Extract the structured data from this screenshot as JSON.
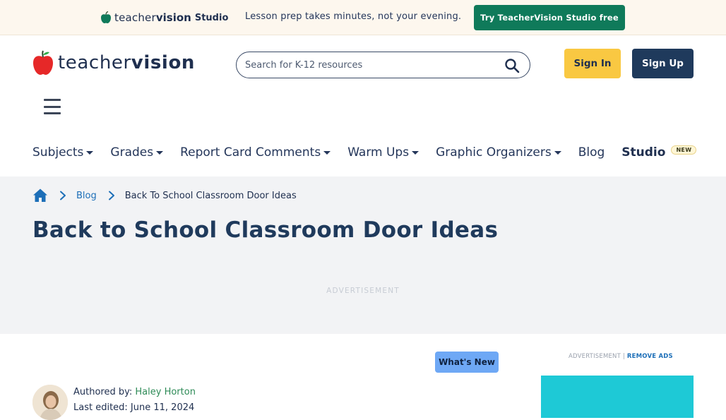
{
  "promo": {
    "logo_teacher": "teacher",
    "logo_vision": "vision",
    "logo_studio": "Studio",
    "text": "Lesson prep takes minutes, not your evening.",
    "cta_label": "Try TeacherVision Studio free"
  },
  "header": {
    "logo_teacher": "teacher",
    "logo_vision": "vision",
    "search_placeholder": "Search for K-12 resources",
    "signin_label": "Sign In",
    "signup_label": "Sign Up"
  },
  "nav": {
    "items": [
      {
        "label": "Subjects",
        "dropdown": true
      },
      {
        "label": "Grades",
        "dropdown": true
      },
      {
        "label": "Report Card Comments",
        "dropdown": true
      },
      {
        "label": "Warm Ups",
        "dropdown": true
      },
      {
        "label": "Graphic Organizers",
        "dropdown": true
      },
      {
        "label": "Blog",
        "dropdown": false
      }
    ],
    "studio_label": "Studio",
    "studio_badge": "NEW"
  },
  "breadcrumb": {
    "blog": "Blog",
    "current": "Back To School Classroom Door Ideas"
  },
  "page": {
    "title": "Back to School Classroom Door Ideas",
    "ad_label": "ADVERTISEMENT"
  },
  "content": {
    "whats_new_label": "What's New",
    "side_ad_label": "ADVERTISEMENT |",
    "remove_ads_label": "REMOVE ADS",
    "authored_by_label": "Authored by:",
    "author_name": "Haley Horton",
    "last_edited": "Last edited: June 11, 2024"
  },
  "colors": {
    "brand_navy": "#1f3a5c",
    "promo_green": "#0f7a5a",
    "signin_yellow": "#f9c842",
    "whats_new_blue": "#6ea8f5",
    "side_ad_teal": "#1ec9d6"
  }
}
